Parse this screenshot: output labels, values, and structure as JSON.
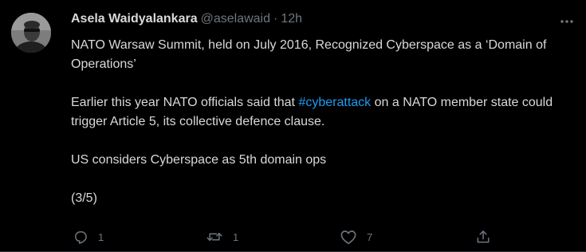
{
  "tweet": {
    "author": {
      "display_name": "Asela Waidyalankara",
      "handle": "@aselawaid",
      "separator": "·",
      "time": "12h"
    },
    "text": {
      "line1": "NATO Warsaw Summit, held on July 2016, Recognized  Cyberspace as a ‘Domain of Operations’",
      "line2_before": "Earlier this year NATO officials said that ",
      "line2_hashtag": "#cyberattack",
      "line2_after": " on a NATO member state could trigger Article 5, its collective defence clause.",
      "line3": "US considers Cyberspace as 5th domain ops",
      "line4": "(3/5)"
    },
    "actions": {
      "reply_count": "1",
      "retweet_count": "1",
      "like_count": "7"
    },
    "colors": {
      "background": "#000000",
      "text": "#d9d9d9",
      "muted": "#6e767d",
      "link": "#1d9bf0"
    },
    "icons": [
      "more-icon",
      "reply-icon",
      "retweet-icon",
      "like-icon",
      "share-icon"
    ]
  }
}
